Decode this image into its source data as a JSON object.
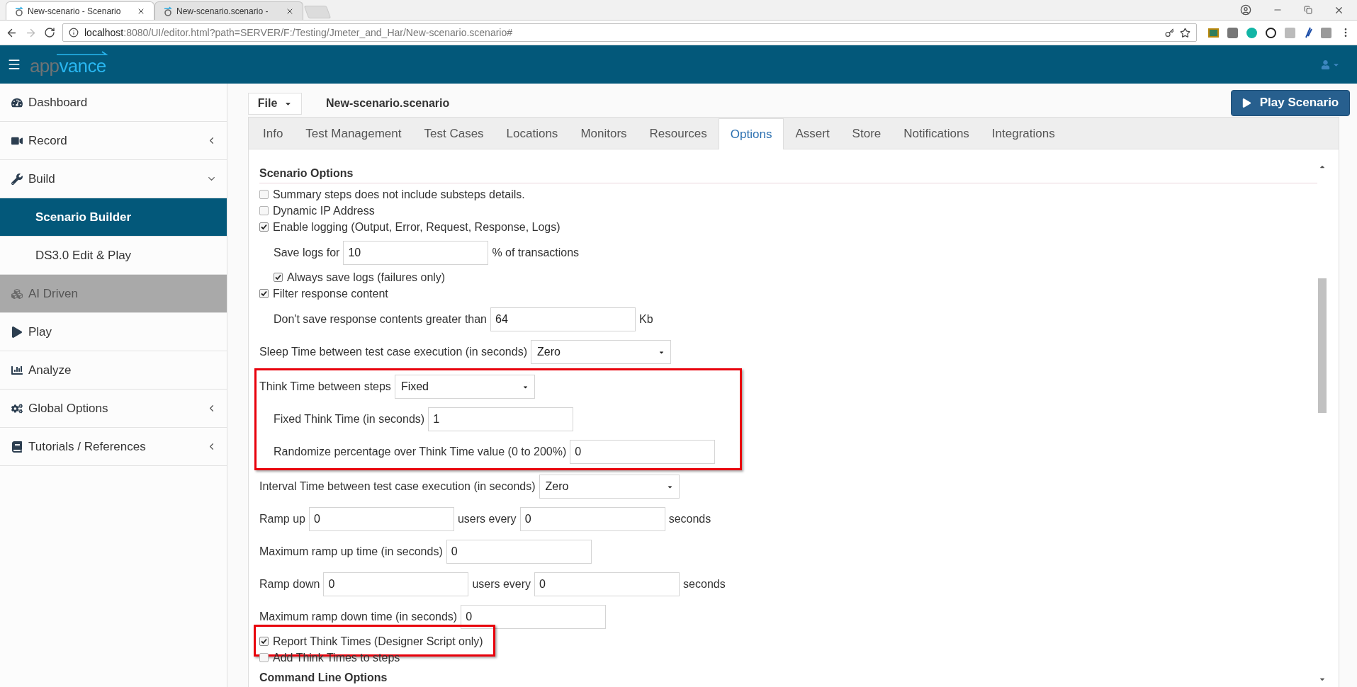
{
  "browser": {
    "tabs": [
      {
        "title": "New-scenario - Scenario",
        "selected": true
      },
      {
        "title": "New-scenario.scenario -",
        "selected": false
      }
    ],
    "url_host": "localhost",
    "url_rest": ":8080/UI/editor.html?path=SERVER/F:/Testing/Jmeter_and_Har/New-scenario.scenario#"
  },
  "app": {
    "logo": [
      "app",
      "vance"
    ]
  },
  "sidebar": {
    "items": [
      {
        "label": "Dashboard",
        "disabled": false
      },
      {
        "label": "Record",
        "expanded": false,
        "disabled": false
      },
      {
        "label": "Build",
        "expanded": true,
        "disabled": false,
        "children": [
          {
            "label": "Scenario Builder",
            "selected": true
          },
          {
            "label": "DS3.0 Edit & Play",
            "selected": false
          }
        ]
      },
      {
        "label": "AI Driven",
        "disabled": true
      },
      {
        "label": "Play",
        "disabled": false
      },
      {
        "label": "Analyze",
        "disabled": false
      },
      {
        "label": "Global Options",
        "expanded": false,
        "disabled": false
      },
      {
        "label": "Tutorials / References",
        "expanded": false,
        "disabled": false
      }
    ]
  },
  "toolbar": {
    "file_menu": "File",
    "document_title": "New-scenario.scenario",
    "play_button": "Play Scenario"
  },
  "tabs": [
    {
      "label": "Info",
      "selected": false
    },
    {
      "label": "Test Management",
      "selected": false
    },
    {
      "label": "Test Cases",
      "selected": false
    },
    {
      "label": "Locations",
      "selected": false
    },
    {
      "label": "Monitors",
      "selected": false
    },
    {
      "label": "Resources",
      "selected": false
    },
    {
      "label": "Options",
      "selected": true
    },
    {
      "label": "Assert",
      "selected": false
    },
    {
      "label": "Store",
      "selected": false
    },
    {
      "label": "Notifications",
      "selected": false
    },
    {
      "label": "Integrations",
      "selected": false
    }
  ],
  "options": {
    "heading": "Scenario Options",
    "rows": [
      {
        "kind": "checkbox",
        "label": "Summary steps does not include substeps details.",
        "checked": false
      },
      {
        "kind": "checkbox",
        "label": "Dynamic IP Address",
        "checked": false
      },
      {
        "kind": "checkbox",
        "label": "Enable logging (Output, Error, Request, Response, Logs)",
        "checked": true,
        "children": [
          {
            "kind": "fields",
            "parts": [
              {
                "kind": "label",
                "text": "Save logs for"
              },
              {
                "kind": "input",
                "value": "10"
              },
              {
                "kind": "label",
                "text": "% of transactions"
              }
            ]
          },
          {
            "kind": "checkbox",
            "label": "Always save logs (failures only)",
            "checked": true
          }
        ]
      },
      {
        "kind": "checkbox",
        "label": "Filter response content",
        "checked": true,
        "children": [
          {
            "kind": "fields",
            "parts": [
              {
                "kind": "label",
                "text": "Don't save response contents greater than"
              },
              {
                "kind": "input",
                "value": "64"
              },
              {
                "kind": "label",
                "text": "Kb"
              }
            ]
          }
        ]
      },
      {
        "kind": "fields",
        "parts": [
          {
            "kind": "label",
            "text": "Sleep Time between test case execution (in seconds)"
          },
          {
            "kind": "select",
            "value": "Zero"
          }
        ]
      },
      {
        "kind": "fields",
        "highlighted": true,
        "parts": [
          {
            "kind": "label",
            "text": "Think Time between steps"
          },
          {
            "kind": "select",
            "value": "Fixed"
          }
        ],
        "children": [
          {
            "kind": "fields",
            "parts": [
              {
                "kind": "label",
                "text": "Fixed Think Time (in seconds)"
              },
              {
                "kind": "input",
                "value": "1"
              }
            ]
          },
          {
            "kind": "fields",
            "parts": [
              {
                "kind": "label",
                "text": "Randomize percentage over Think Time value (0 to 200%)"
              },
              {
                "kind": "input",
                "value": "0"
              }
            ]
          }
        ]
      },
      {
        "kind": "fields",
        "parts": [
          {
            "kind": "label",
            "text": "Interval Time between test case execution (in seconds)"
          },
          {
            "kind": "select",
            "value": "Zero"
          }
        ]
      },
      {
        "kind": "fields",
        "parts": [
          {
            "kind": "label",
            "text": "Ramp up"
          },
          {
            "kind": "input",
            "value": "0"
          },
          {
            "kind": "label",
            "text": "users every"
          },
          {
            "kind": "input",
            "value": "0"
          },
          {
            "kind": "label",
            "text": "seconds"
          }
        ]
      },
      {
        "kind": "fields",
        "parts": [
          {
            "kind": "label",
            "text": "Maximum ramp up time (in seconds)"
          },
          {
            "kind": "input",
            "value": "0"
          }
        ]
      },
      {
        "kind": "fields",
        "parts": [
          {
            "kind": "label",
            "text": "Ramp down"
          },
          {
            "kind": "input",
            "value": "0"
          },
          {
            "kind": "label",
            "text": "users every"
          },
          {
            "kind": "input",
            "value": "0"
          },
          {
            "kind": "label",
            "text": "seconds"
          }
        ]
      },
      {
        "kind": "fields",
        "parts": [
          {
            "kind": "label",
            "text": "Maximum ramp down time (in seconds)"
          },
          {
            "kind": "input",
            "value": "0"
          }
        ]
      },
      {
        "kind": "checkbox",
        "label": "Report Think Times (Designer Script only)",
        "checked": true,
        "highlighted": true
      },
      {
        "kind": "checkbox",
        "label": "Add Think Times to steps",
        "checked": false
      }
    ],
    "next_heading": "Command Line Options"
  }
}
